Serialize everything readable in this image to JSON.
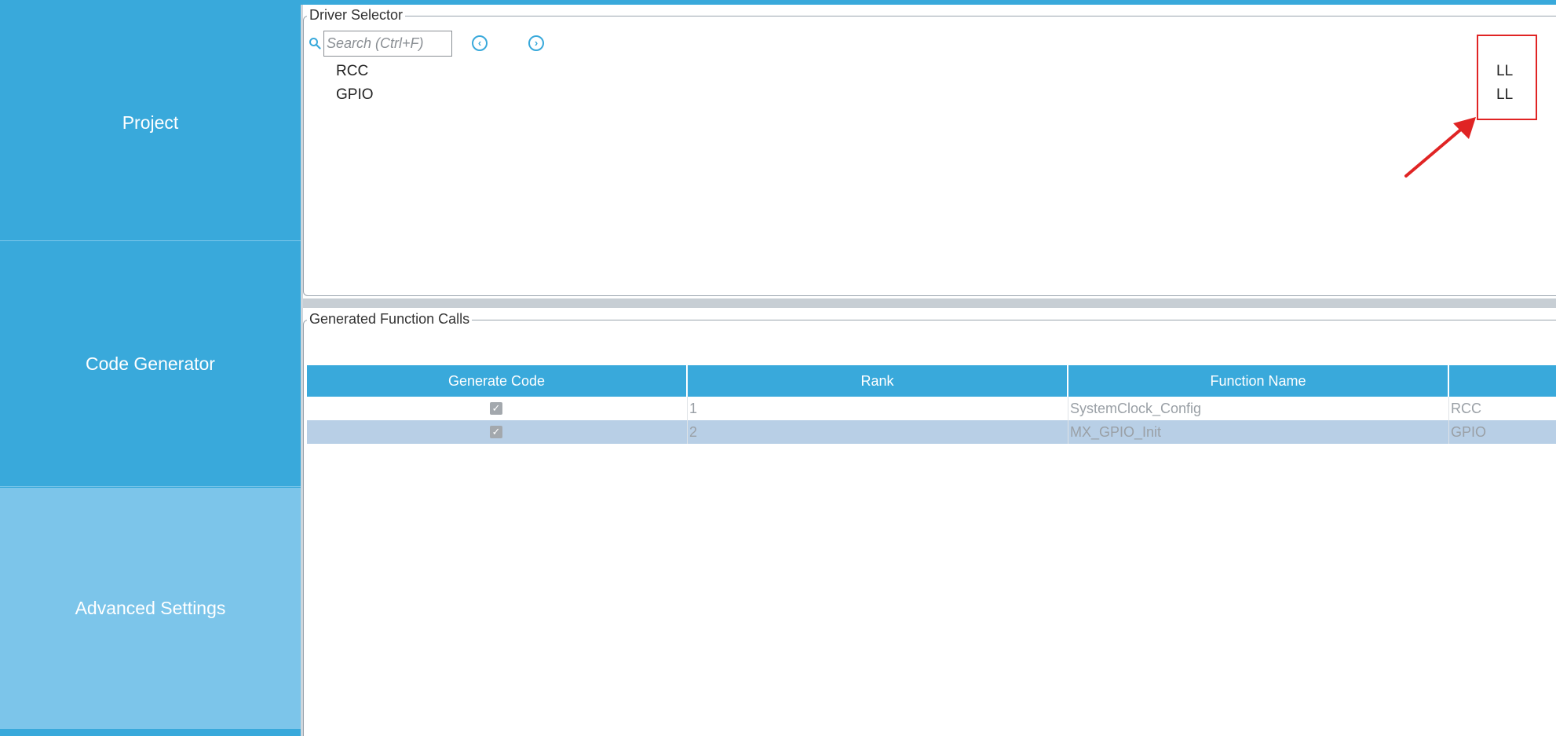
{
  "sidebar": {
    "items": [
      {
        "label": "Project"
      },
      {
        "label": "Code Generator"
      },
      {
        "label": "Advanced Settings"
      }
    ]
  },
  "driver_selector": {
    "title": "Driver Selector",
    "search_placeholder": "Search (Ctrl+F)",
    "drivers": [
      {
        "name": "RCC",
        "type": "LL"
      },
      {
        "name": "GPIO",
        "type": "LL"
      }
    ]
  },
  "generated_calls": {
    "title": "Generated Function Calls",
    "columns": [
      "Generate Code",
      "Rank",
      "Function Name",
      ""
    ],
    "rows": [
      {
        "generate": true,
        "rank": "1",
        "function": "SystemClock_Config",
        "ip": "RCC"
      },
      {
        "generate": true,
        "rank": "2",
        "function": "MX_GPIO_Init",
        "ip": "GPIO"
      }
    ]
  },
  "colors": {
    "accent": "#39a9db",
    "sidebar_selected": "#7cc5ea",
    "selected_row": "#b8cfe6",
    "annotation": "#e02424"
  },
  "icons": {
    "search": "search-icon",
    "prev": "chevron-left-circle-icon",
    "next": "chevron-right-circle-icon",
    "check": "checkbox-checked-icon"
  }
}
